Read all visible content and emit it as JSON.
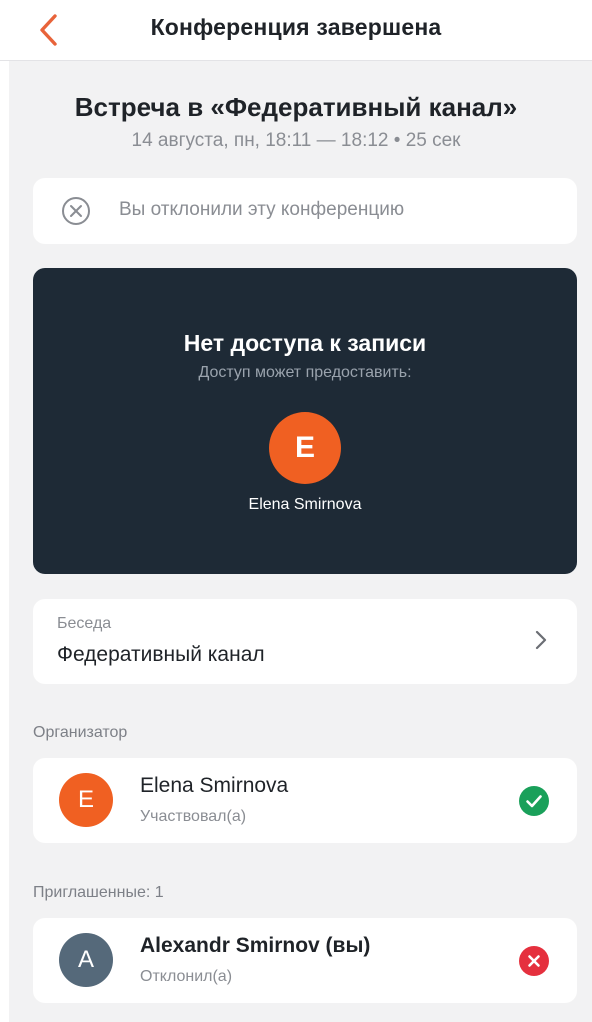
{
  "header": {
    "title": "Конференция завершена"
  },
  "meeting": {
    "title": "Встреча в «Федеративный канал»",
    "subtitle": "14 августа, пн, 18:11 — 18:12 • 25 сек"
  },
  "declined_notice": {
    "text": "Вы отклонили эту конференцию"
  },
  "recording": {
    "title": "Нет доступа к записи",
    "subtitle": "Доступ может предоставить:",
    "owner_initial": "E",
    "owner_name": "Elena Smirnova"
  },
  "chat": {
    "label": "Беседа",
    "value": "Федеративный канал"
  },
  "organizer": {
    "section_label": "Организатор",
    "initial": "E",
    "name": "Elena Smirnova",
    "status": "Участвовал(а)",
    "status_icon": "check-circle-icon"
  },
  "invited": {
    "section_label": "Приглашенные: 1",
    "initial": "A",
    "name": "Alexandr Smirnov (вы)",
    "status": "Отклонил(а)",
    "status_icon": "x-circle-icon"
  },
  "colors": {
    "accent": "#f06022",
    "dark_card": "#1e2a36",
    "success": "#1aa05a",
    "danger": "#e5303e",
    "avatar_gray": "#55697a"
  }
}
